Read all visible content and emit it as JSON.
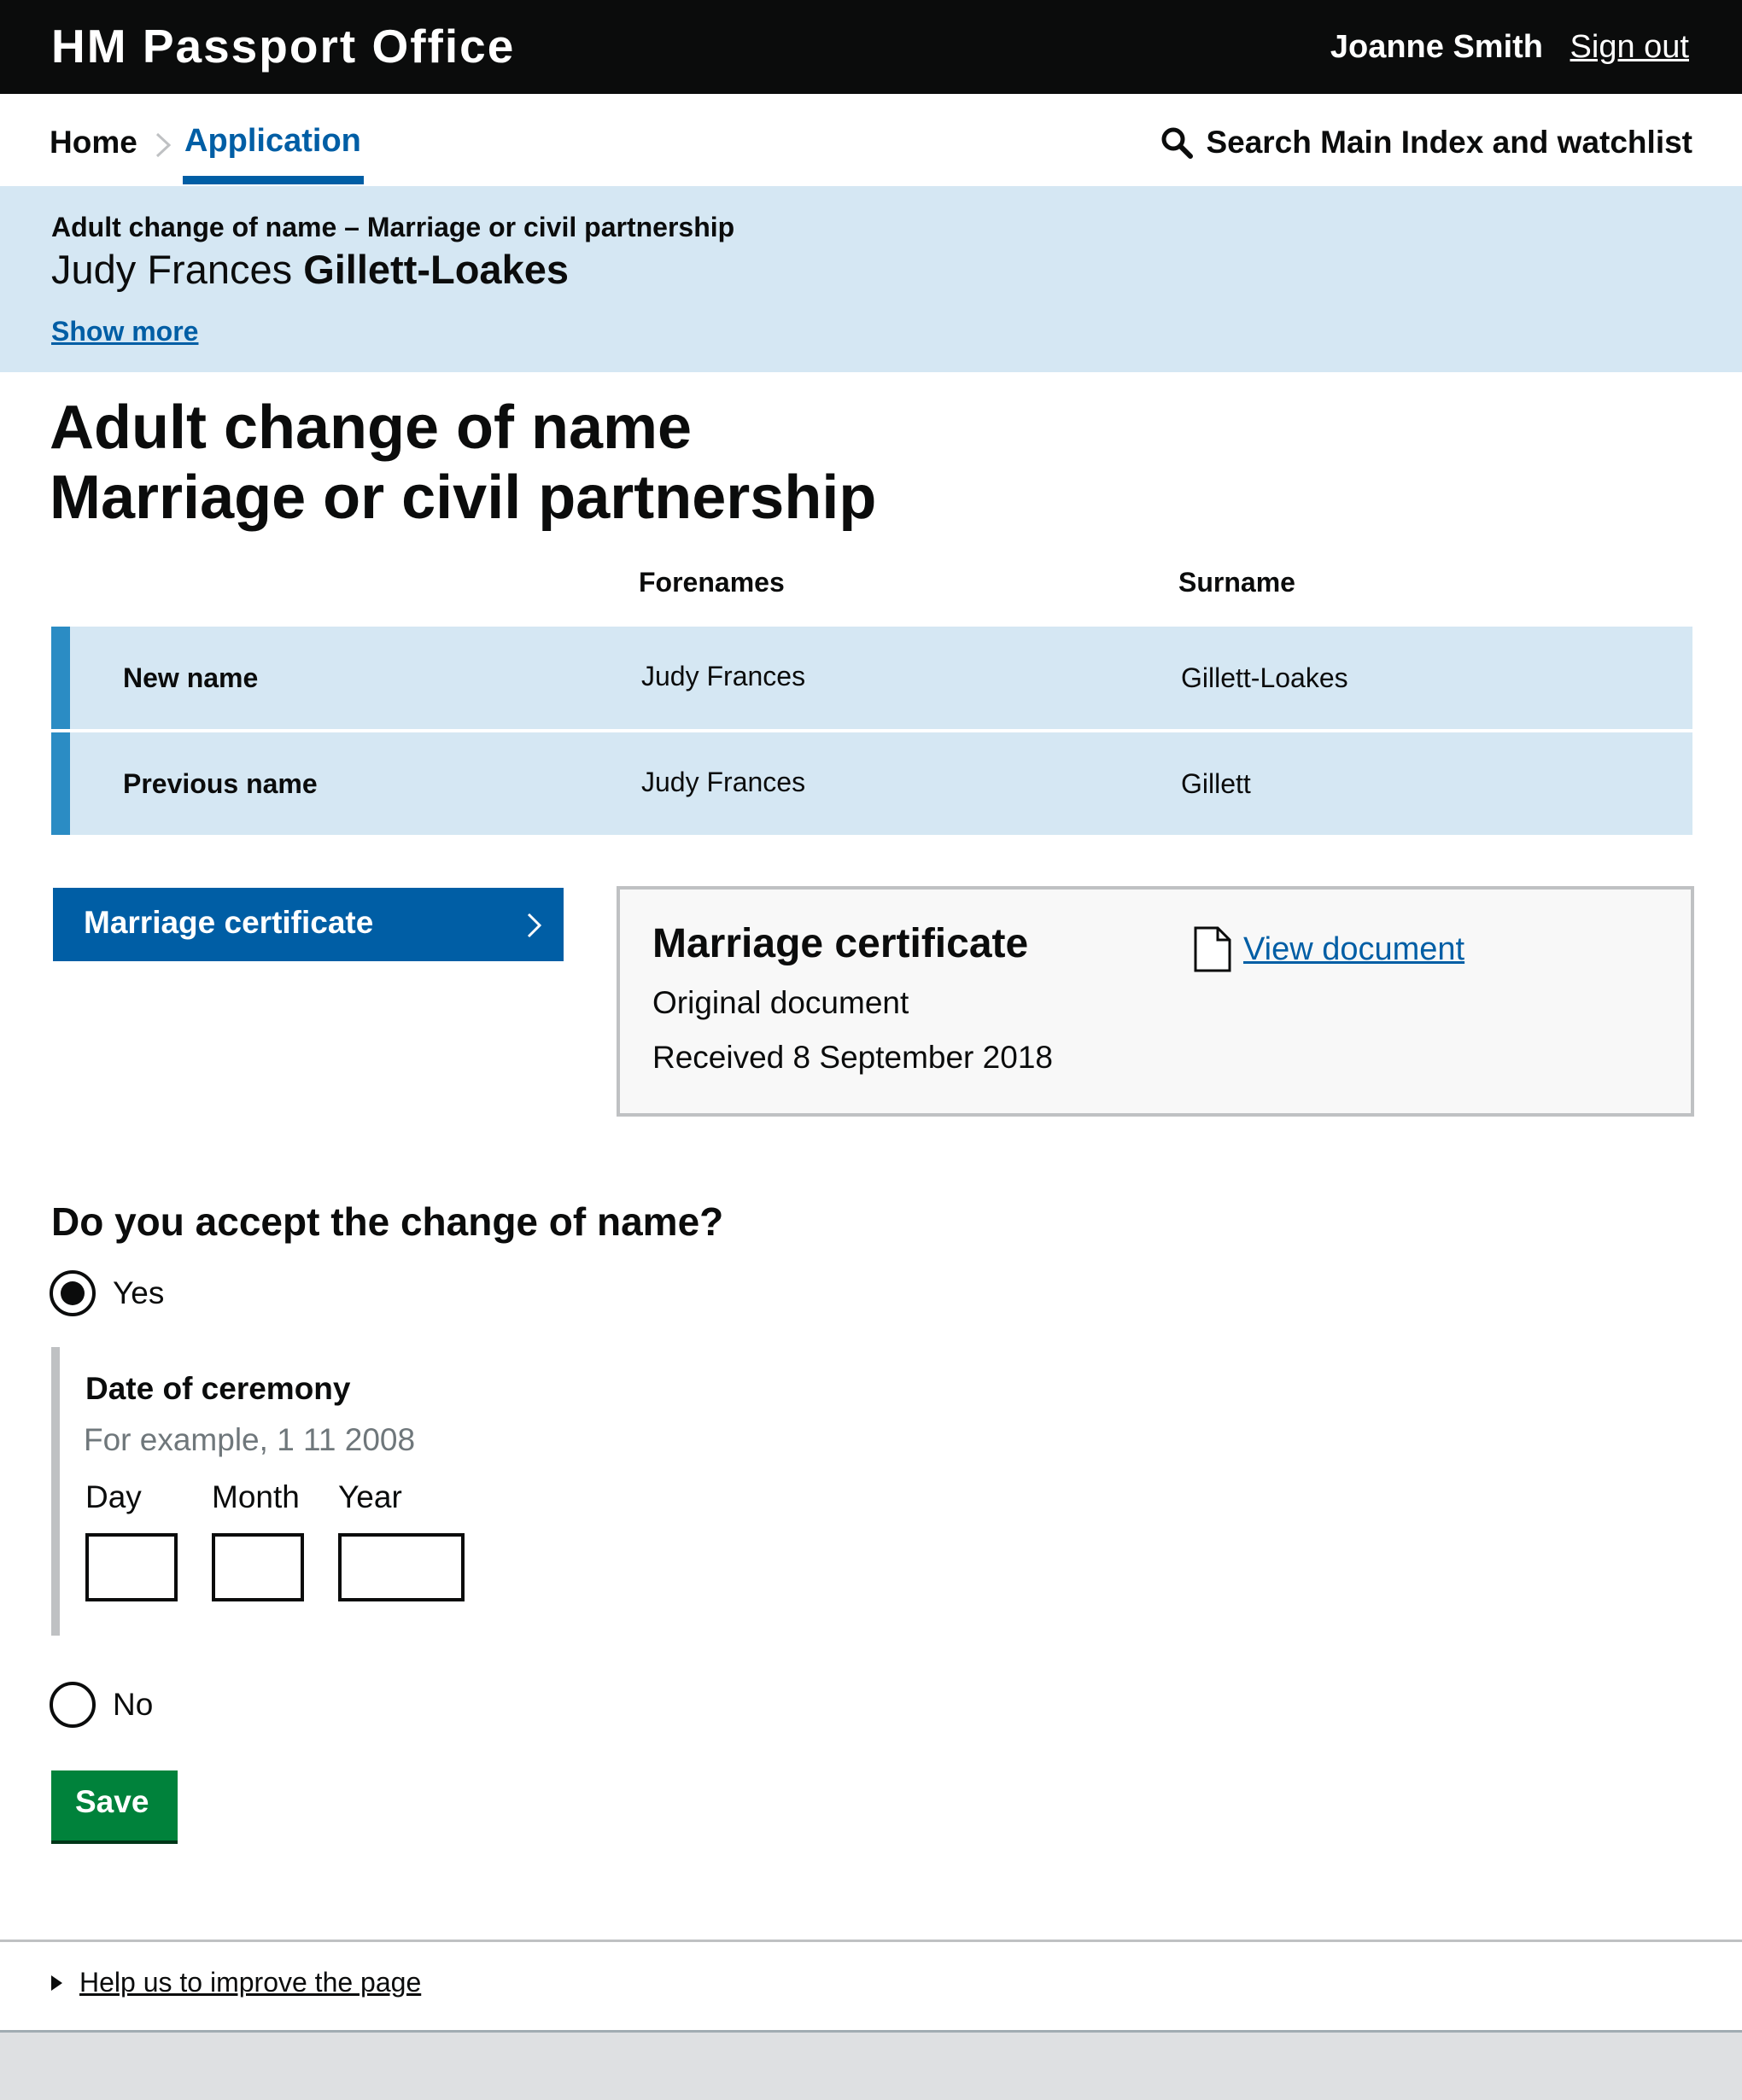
{
  "header": {
    "brand": "HM Passport Office",
    "user_name": "Joanne Smith",
    "sign_out": "Sign out"
  },
  "nav": {
    "home": "Home",
    "application": "Application",
    "search": "Search Main Index and watchlist"
  },
  "summary": {
    "subtitle": "Adult change of name – Marriage or civil partnership",
    "forenames": "Judy Frances",
    "surname": "Gillett-Loakes",
    "show_more": "Show more"
  },
  "page": {
    "title_line1": "Adult change of name",
    "title_line2": "Marriage or civil partnership"
  },
  "names_table": {
    "headers": [
      "Forenames",
      "Surname"
    ],
    "rows": [
      {
        "label": "New name",
        "forenames": "Judy Frances",
        "surname": "Gillett-Loakes"
      },
      {
        "label": "Previous name",
        "forenames": "Judy Frances",
        "surname": "Gillett"
      }
    ]
  },
  "document": {
    "button_label": "Marriage certificate",
    "title": "Marriage certificate",
    "type": "Original document",
    "received": "Received 8 September 2018",
    "view_link": "View document",
    "icon": "document-icon"
  },
  "question": {
    "text": "Do you accept the change of name?",
    "options": [
      {
        "label": "Yes",
        "selected": true
      },
      {
        "label": "No",
        "selected": false
      }
    ],
    "date": {
      "title": "Date of ceremony",
      "hint": "For example, 1 11 2008",
      "fields": [
        {
          "label": "Day",
          "value": ""
        },
        {
          "label": "Month",
          "value": ""
        },
        {
          "label": "Year",
          "value": ""
        }
      ]
    },
    "save_label": "Save"
  },
  "footer": {
    "help_link": "Help us to improve the page"
  },
  "colors": {
    "header_bg": "#0b0c0c",
    "link_blue": "#005ea5",
    "banner_bg": "#d5e7f3",
    "row_accent": "#2b8cc4",
    "save_green": "#00823b"
  }
}
